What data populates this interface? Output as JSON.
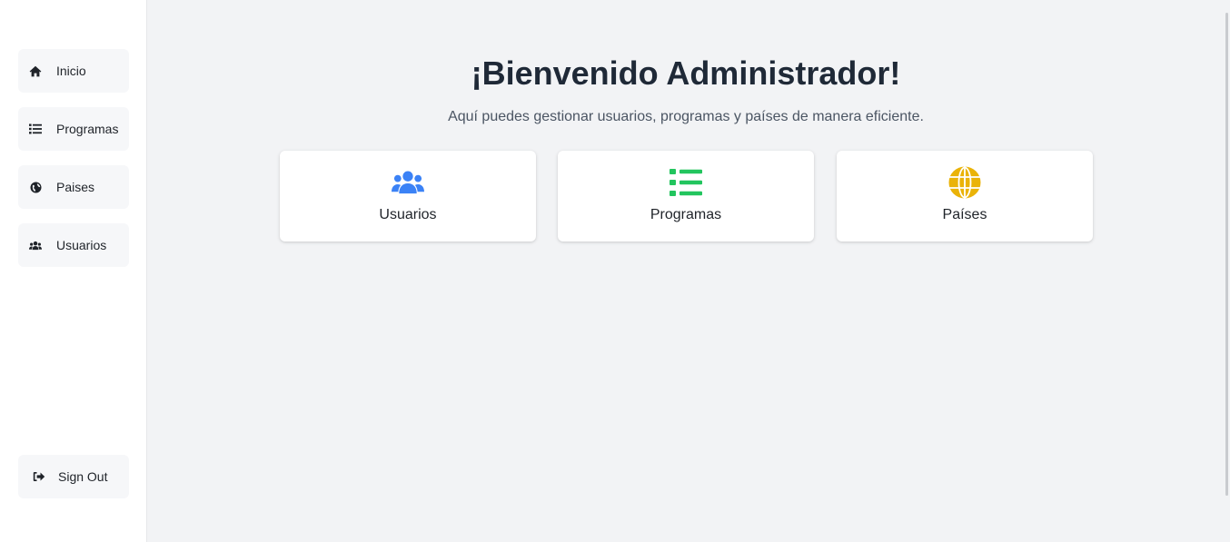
{
  "sidebar": {
    "items": [
      {
        "label": "Inicio",
        "icon": "home-icon"
      },
      {
        "label": "Programas",
        "icon": "list-icon"
      },
      {
        "label": "Paises",
        "icon": "globe-icon"
      },
      {
        "label": "Usuarios",
        "icon": "users-icon"
      }
    ],
    "signout": {
      "label": "Sign Out",
      "icon": "sign-out-icon"
    }
  },
  "main": {
    "title": "¡Bienvenido Administrador!",
    "subtitle": "Aquí puedes gestionar usuarios, programas y países de manera eficiente.",
    "cards": [
      {
        "label": "Usuarios",
        "icon": "users-icon",
        "color": "#3b82f6"
      },
      {
        "label": "Programas",
        "icon": "list-icon",
        "color": "#22c55e"
      },
      {
        "label": "Países",
        "icon": "globe-icon",
        "color": "#eab308"
      }
    ]
  }
}
